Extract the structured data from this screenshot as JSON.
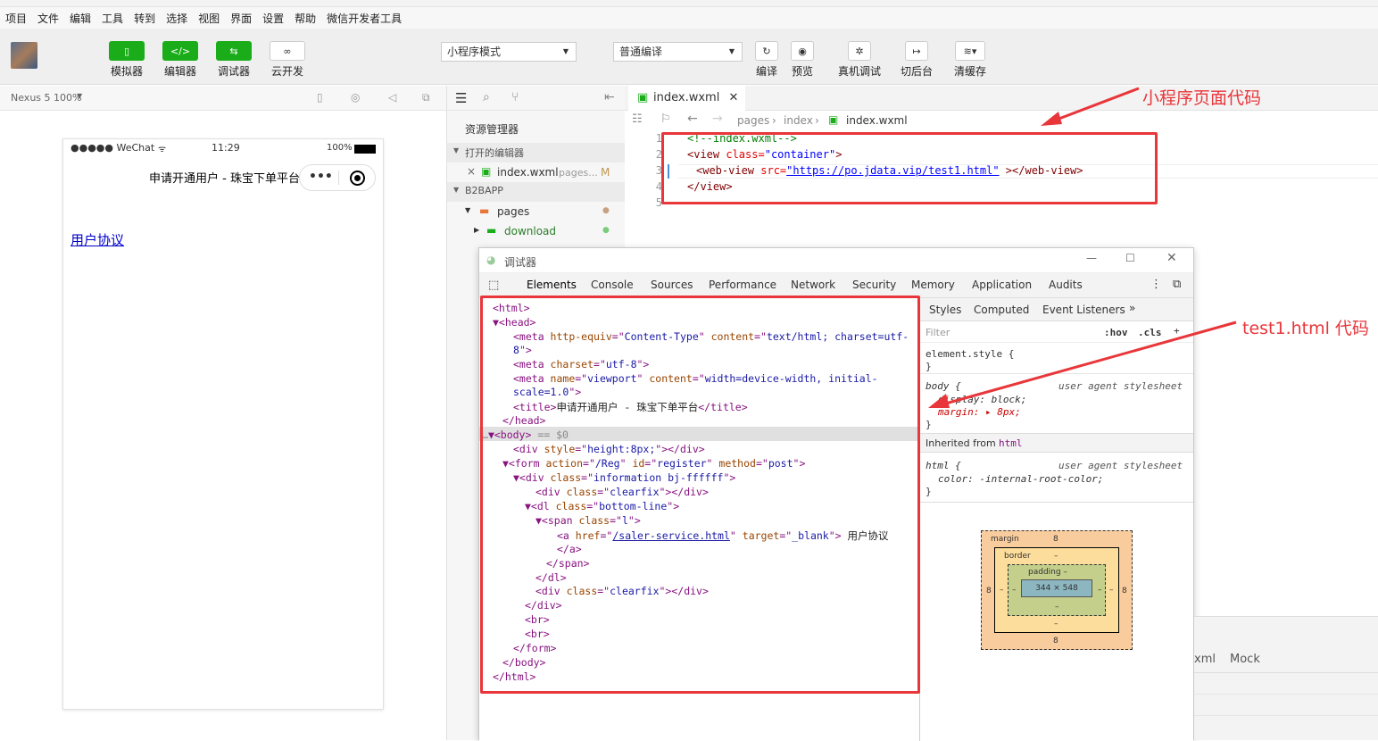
{
  "menu": [
    "项目",
    "文件",
    "编辑",
    "工具",
    "转到",
    "选择",
    "视图",
    "界面",
    "设置",
    "帮助",
    "微信开发者工具"
  ],
  "toolbar": {
    "simulator": "模拟器",
    "editor": "编辑器",
    "debugger": "调试器",
    "cloud": "云开发",
    "mode": "小程序模式",
    "compile_mode": "普通编译",
    "compile": "编译",
    "preview": "预览",
    "real_debug": "真机调试",
    "background": "切后台",
    "clear_cache": "清缓存"
  },
  "sim": {
    "device": "Nexus 5 100%",
    "carrier": "●●●●● WeChat",
    "time": "11:29",
    "battery": "100%",
    "page_title": "申请开通用户 - 珠宝下单平台",
    "link": "用户协议"
  },
  "explorer": {
    "title": "资源管理器",
    "open_editors": "打开的编辑器",
    "open_file": "index.wxml",
    "open_file_path": "pages...",
    "open_file_status": "M",
    "project": "B2BAPP",
    "pages": "pages",
    "download": "download"
  },
  "editor": {
    "tab": "index.wxml",
    "crumb_pages": "pages",
    "crumb_index": "index",
    "crumb_file": "index.wxml",
    "lines": [
      "1",
      "2",
      "3",
      "4",
      "5"
    ],
    "code1": "<!--index.wxml-->",
    "code2_tag": "<view ",
    "code2_attr": "class=",
    "code2_val": "\"container\"",
    "code2_end": ">",
    "code3_tag": "<web-view ",
    "code3_attr": "src=",
    "code3_val": "\"https://po.jdata.vip/test1.html\"",
    "code3_end": " ></web-view>",
    "code4": "</view>"
  },
  "annotations": {
    "top": "小程序页面代码",
    "right": "test1.html 代码"
  },
  "debugger": {
    "title": "调试器",
    "tabs": [
      "Elements",
      "Console",
      "Sources",
      "Performance",
      "Network",
      "Security",
      "Memory",
      "Application",
      "Audits"
    ],
    "style_tabs": [
      "Styles",
      "Computed",
      "Event Listeners"
    ],
    "filter": "Filter",
    "hov": ":hov",
    ".cls": ".cls",
    "element_style": "element.style {",
    "close_brace": "}",
    "body_sel": "body {",
    "ua": "user agent stylesheet",
    "display": "display: block;",
    "margin": "margin: ▸ 8px;",
    "inherited": "Inherited from",
    "inherited_el": "html",
    "html_sel": "html {",
    "color": "color: -internal-root-color;",
    "box": {
      "margin": "margin",
      "margin_val": "8",
      "border": "border",
      "border_val": "–",
      "padding": "padding –",
      "content": "344 × 548",
      "dash": "–"
    }
  },
  "lower_right": {
    "tab1": "xml",
    "tab2": "Mock"
  }
}
